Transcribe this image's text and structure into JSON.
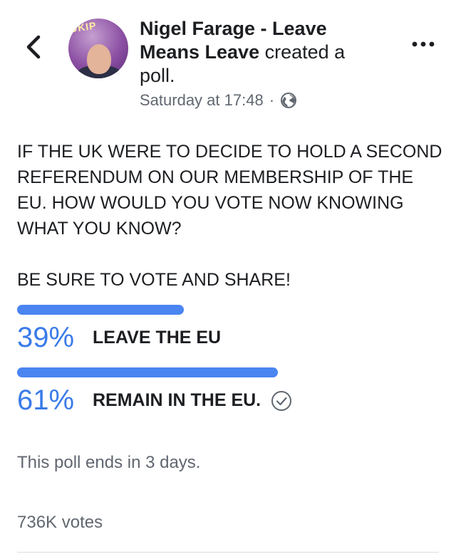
{
  "header": {
    "back_icon": "chevron-left-icon",
    "poster_name": "Nigel Farage - Leave Means Leave",
    "action_text": " created a poll.",
    "timestamp": "Saturday at 17:48",
    "separator": "·",
    "privacy_icon": "globe-icon",
    "more_icon": "more-horizontal-icon",
    "avatar_text": "UKIP"
  },
  "post": {
    "question": "IF THE UK WERE TO DECIDE TO HOLD A SECOND REFERENDUM ON OUR MEMBERSHIP OF THE EU. HOW WOULD YOU VOTE NOW KNOWING WHAT YOU KNOW?",
    "call_to_action": "BE SURE TO VOTE AND SHARE!"
  },
  "poll": {
    "bar_color": "#4a85f1",
    "options": [
      {
        "percent_text": "39%",
        "percent": 39,
        "label": "LEAVE THE EU",
        "selected": false
      },
      {
        "percent_text": "61%",
        "percent": 61,
        "label": "REMAIN IN THE EU.",
        "selected": true
      }
    ],
    "ends_text": "This poll ends in 3 days.",
    "votes_text": "736K votes"
  }
}
